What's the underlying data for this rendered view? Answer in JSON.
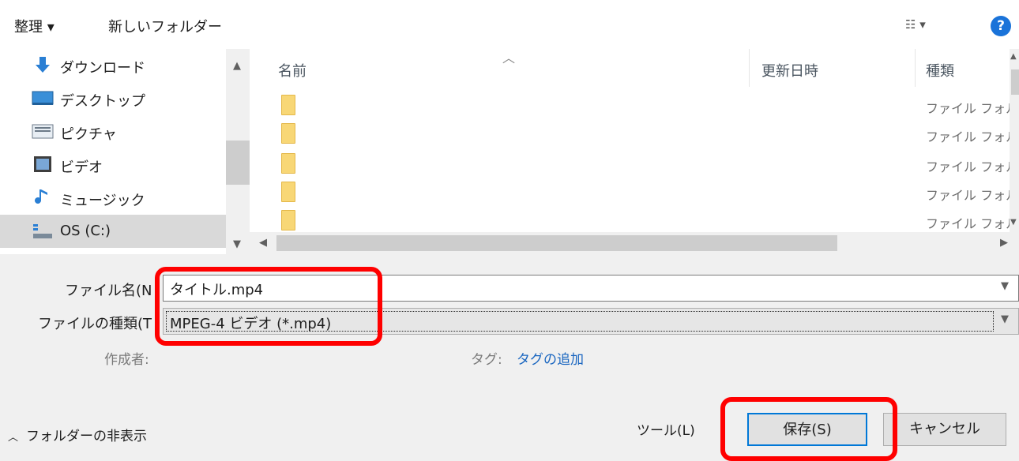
{
  "toolbar": {
    "organize_label": "整理 ▾",
    "new_folder_label": "新しいフォルダー",
    "view_label": "☷ ▾",
    "help_label": "?"
  },
  "nav": {
    "items": [
      {
        "label": "ダウンロード",
        "icon": "download-arrow-icon"
      },
      {
        "label": "デスクトップ",
        "icon": "desktop-icon"
      },
      {
        "label": "ピクチャ",
        "icon": "pictures-icon"
      },
      {
        "label": "ビデオ",
        "icon": "video-icon"
      },
      {
        "label": "ミュージック",
        "icon": "music-note-icon"
      },
      {
        "label": "OS (C:)",
        "icon": "drive-icon",
        "selected": true
      }
    ]
  },
  "filelist": {
    "columns": {
      "name": "名前",
      "modified": "更新日時",
      "type": "種類"
    },
    "rows": [
      {
        "type": "ファイル フォル"
      },
      {
        "type": "ファイル フォル"
      },
      {
        "type": "ファイル フォル"
      },
      {
        "type": "ファイル フォル"
      },
      {
        "type": "ファイル フォル"
      }
    ]
  },
  "form": {
    "filename_label": "ファイル名(N",
    "filename_value": "タイトル.mp4",
    "filetype_label": "ファイルの種類(T",
    "filetype_value": "MPEG-4 ビデオ (*.mp4)",
    "author_label": "作成者:",
    "tags_label": "タグ:",
    "tags_link": "タグの追加"
  },
  "footer": {
    "hide_folders_label": "フォルダーの非表示",
    "tools_label": "ツール(L)",
    "save_label": "保存(S)",
    "cancel_label": "キャンセル"
  },
  "colors": {
    "accent": "#0078d7",
    "highlight": "#ff0000",
    "folder": "#f8d776",
    "link": "#1a66c0"
  }
}
